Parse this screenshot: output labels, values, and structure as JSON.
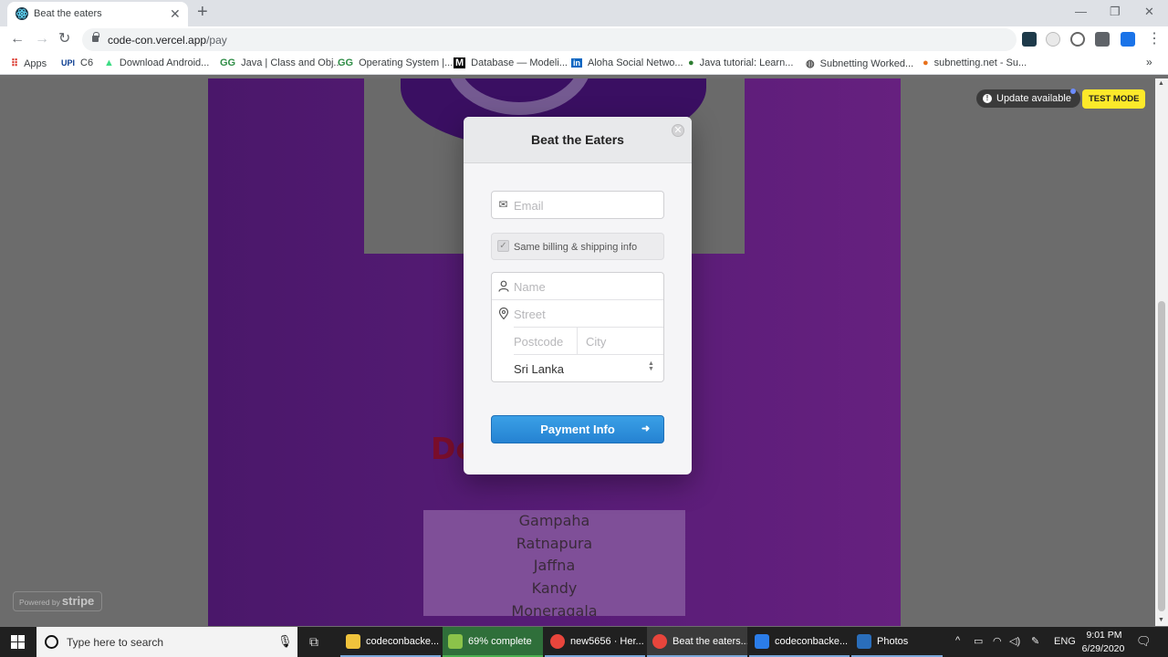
{
  "browser": {
    "tab_title": "Beat the eaters",
    "tab_close": "✕",
    "new_tab": "+",
    "url_host": "code-con.vercel.app",
    "url_path": "/pay",
    "win_min": "—",
    "win_restore": "❐",
    "win_close": "✕",
    "back": "←",
    "forward": "→",
    "reload": "↻",
    "star": "☆",
    "more": "⋮"
  },
  "bookmarks": [
    {
      "icon": "⠿",
      "label": "Apps"
    },
    {
      "icon": "UPI",
      "label": "C6"
    },
    {
      "icon": "▲",
      "label": "Download Android..."
    },
    {
      "icon": "GG",
      "label": "Java | Class and Obj..."
    },
    {
      "icon": "GG",
      "label": "Operating System |..."
    },
    {
      "icon": "M",
      "label": "Database — Modeli..."
    },
    {
      "icon": "in",
      "label": "Aloha Social Netwo..."
    },
    {
      "icon": "●",
      "label": "Java tutorial: Learn..."
    },
    {
      "icon": "◍",
      "label": "Subnetting Worked..."
    },
    {
      "icon": "●",
      "label": "subnetting.net - Su..."
    }
  ],
  "bookmarks_more": "»",
  "site": {
    "heading_partial": "Do",
    "districts": [
      "Gampaha",
      "Ratnapura",
      "Jaffna",
      "Kandy",
      "Moneragala"
    ]
  },
  "page_badges": {
    "update_label": "Update available",
    "update_icon": "!",
    "test_mode": "TEST MODE",
    "powered_by": "Powered by",
    "powered_brand": "stripe"
  },
  "stripe_modal": {
    "title": "Beat the Eaters",
    "close": "✕",
    "email_placeholder": "Email",
    "email_icon": "✉",
    "same_billing_label": "Same billing & shipping info",
    "same_billing_checked": true,
    "check_mark": "✓",
    "name_placeholder": "Name",
    "name_icon": "👤",
    "street_placeholder": "Street",
    "street_icon": "📍",
    "postcode_placeholder": "Postcode",
    "city_placeholder": "City",
    "country": "Sri Lanka",
    "country_arrows": "▲▼",
    "pay_button": "Payment Info",
    "pay_arrow": "➜"
  },
  "taskbar": {
    "search_text": "Type here to search",
    "mic": "🎙",
    "task_view": "⧉",
    "items": [
      {
        "label": "codeconbacke...",
        "color": "#f0c33c"
      },
      {
        "label": "69% complete",
        "color": "#4caf50"
      },
      {
        "label": "new5656 · Her...",
        "color": "#e8453c"
      },
      {
        "label": "Beat the eaters...",
        "color": "#e8453c"
      },
      {
        "label": "codeconbacke...",
        "color": "#2b7de9"
      },
      {
        "label": "Photos",
        "color": "#2a6ebb"
      }
    ],
    "tray_chevron": "^",
    "tray_lang": "ENG",
    "time": "9:01 PM",
    "date": "6/29/2020",
    "notifications": "🗨"
  },
  "colors": {
    "accent_pay": "#2582d2",
    "test_mode": "#fce92a",
    "site_purple": "#571c76"
  }
}
